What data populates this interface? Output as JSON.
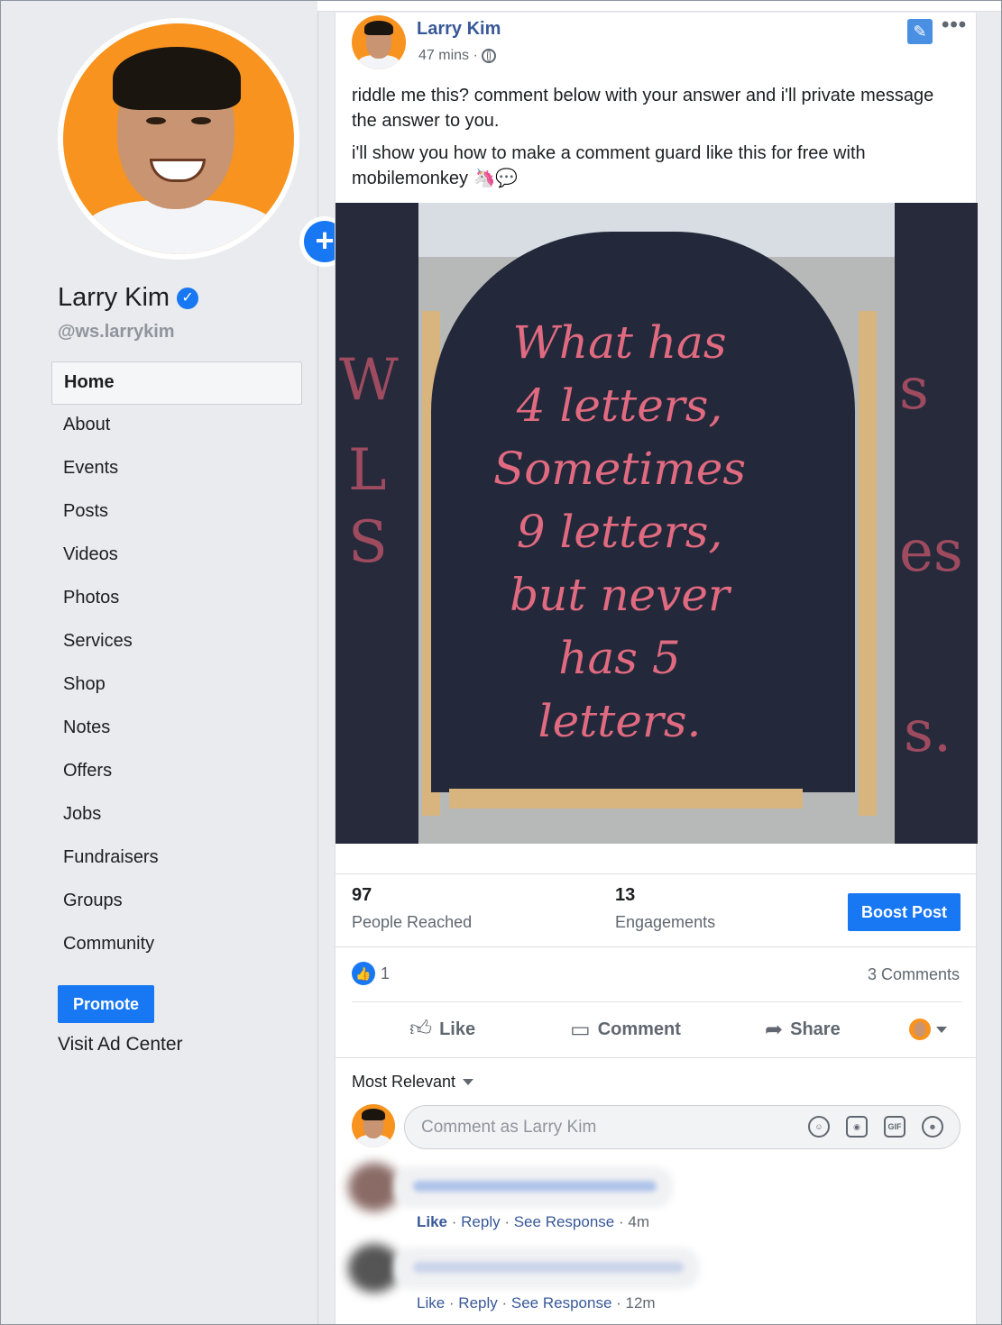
{
  "sidebar": {
    "name": "Larry Kim",
    "handle": "@ws.larrykim",
    "nav": [
      {
        "label": "Home",
        "active": true
      },
      {
        "label": "About"
      },
      {
        "label": "Events"
      },
      {
        "label": "Posts"
      },
      {
        "label": "Videos"
      },
      {
        "label": "Photos"
      },
      {
        "label": "Services"
      },
      {
        "label": "Shop"
      },
      {
        "label": "Notes"
      },
      {
        "label": "Offers"
      },
      {
        "label": "Jobs"
      },
      {
        "label": "Fundraisers"
      },
      {
        "label": "Groups"
      },
      {
        "label": "Community"
      }
    ],
    "promote_label": "Promote",
    "ad_center_label": "Visit Ad Center"
  },
  "post": {
    "author": "Larry Kim",
    "time": "47 mins ·",
    "text_1": "riddle me this? comment below with your answer and i'll private message the answer to you.",
    "text_2": "i'll show you how to make a comment guard like this for free with mobilemonkey 🦄💬",
    "image_text": [
      "What has",
      "4 letters,",
      "Sometimes",
      "9 letters,",
      "but never",
      "has 5 letters."
    ],
    "stats": {
      "reached_value": "97",
      "reached_label": "People Reached",
      "engagements_value": "13",
      "engagements_label": "Engagements"
    },
    "boost_label": "Boost Post",
    "reaction_count": "1",
    "comments_count": "3 Comments",
    "actions": {
      "like": "Like",
      "comment": "Comment",
      "share": "Share"
    },
    "sort_label": "Most Relevant",
    "comment_placeholder": "Comment as Larry Kim",
    "comments": [
      {
        "like": "Like",
        "reply": "Reply",
        "see_response": "See Response",
        "time": "4m"
      },
      {
        "like": "Like",
        "reply": "Reply",
        "see_response": "See Response",
        "time": "12m"
      }
    ]
  },
  "colors": {
    "accent": "#1877f2",
    "link": "#385898",
    "chalk": "#e06a80"
  },
  "icons": [
    "plus-icon",
    "verified-icon",
    "globe-icon",
    "pin-icon",
    "more-icon",
    "thumbs-up-icon",
    "comment-icon",
    "share-icon",
    "emoji-icon",
    "camera-icon",
    "gif-icon",
    "sticker-icon"
  ]
}
